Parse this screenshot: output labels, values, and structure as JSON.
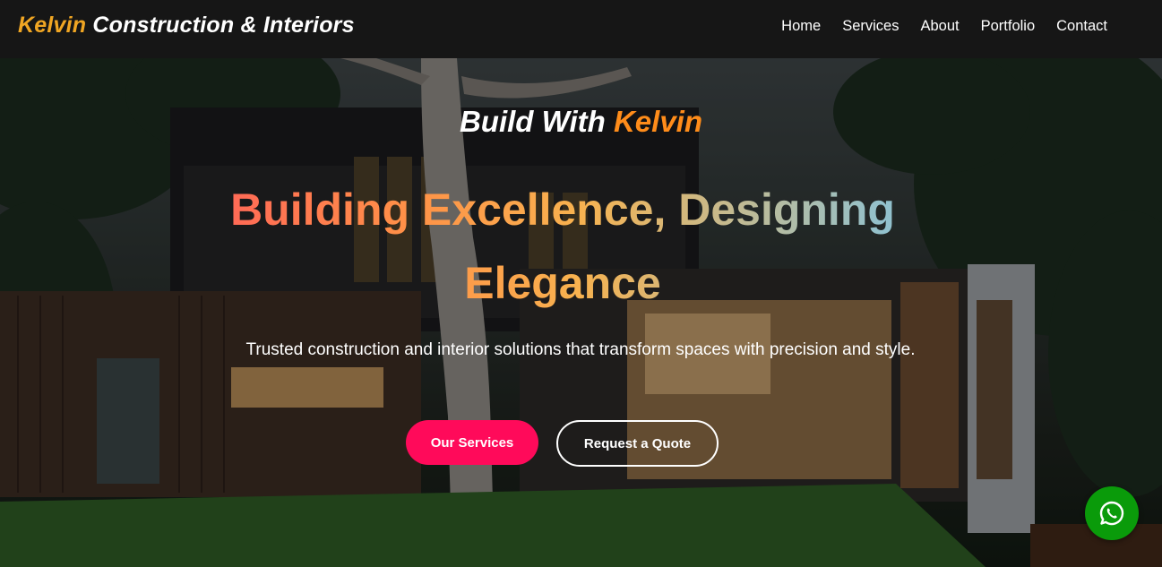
{
  "brand": {
    "accent_word": "Kelvin",
    "rest": " Construction & Interiors"
  },
  "nav": {
    "links": [
      {
        "label": "Home"
      },
      {
        "label": "Services"
      },
      {
        "label": "About"
      },
      {
        "label": "Portfolio"
      },
      {
        "label": "Contact"
      }
    ]
  },
  "hero": {
    "tagline_prefix": "Build With ",
    "tagline_accent": "Kelvin",
    "headline": "Building Excellence, Designing Elegance",
    "subtext": "Trusted construction and interior solutions that transform spaces with precision and style.",
    "primary_button": "Our Services",
    "secondary_button": "Request a Quote"
  },
  "floating": {
    "whatsapp_icon": "whatsapp-icon"
  },
  "colors": {
    "brand_accent": "#f0a623",
    "tagline_accent": "#ff8c1a",
    "primary_button": "#ff0a5a",
    "whatsapp": "#0a9b0a",
    "navbar_bg": "#161616"
  }
}
